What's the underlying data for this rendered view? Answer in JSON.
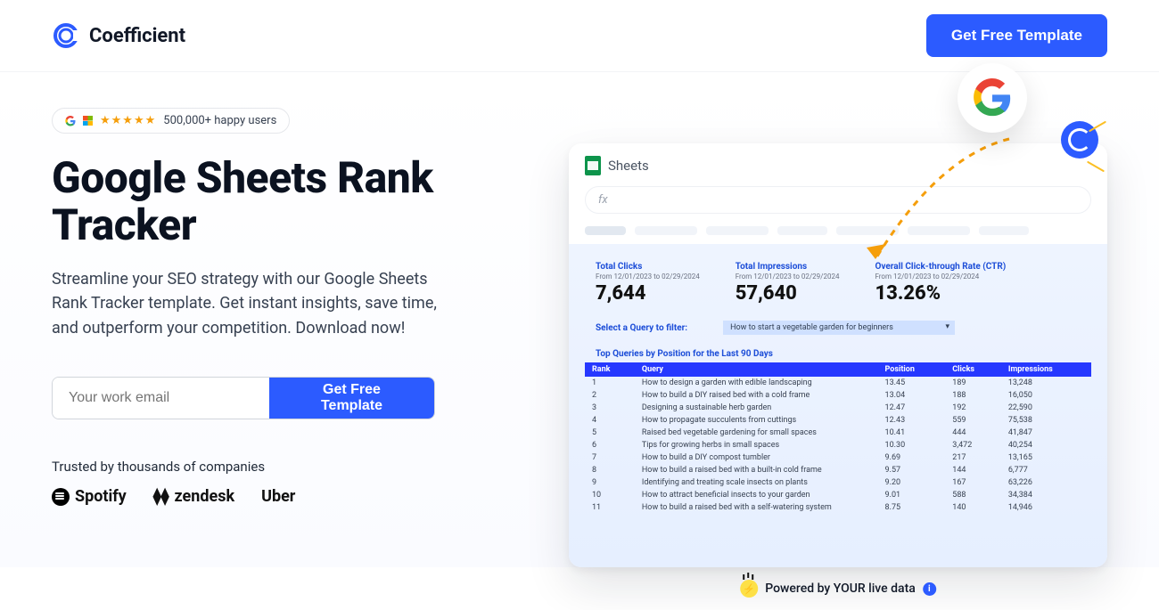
{
  "header": {
    "brand": "Coefficient",
    "cta": "Get Free Template"
  },
  "badge": {
    "stars": "★★★★★",
    "text": "500,000+ happy users"
  },
  "hero": {
    "title": "Google Sheets Rank Tracker",
    "subtitle": "Streamline your SEO strategy with our Google Sheets Rank Tracker template. Get instant insights, save time, and outperform your competition. Download now!",
    "email_placeholder": "Your work email",
    "submit_label": "Get Free Template"
  },
  "trusted": {
    "label": "Trusted by thousands of companies",
    "spotify": "Spotify",
    "zendesk": "zendesk",
    "uber": "Uber"
  },
  "sheet": {
    "app_title": "Sheets",
    "fx": "fx",
    "stats": {
      "clicks_label": "Total Clicks",
      "date_range": "From 12/01/2023 to 02/29/2024",
      "clicks_value": "7,644",
      "impressions_label": "Total Impressions",
      "impressions_value": "57,640",
      "ctr_label": "Overall Click-through Rate (CTR)",
      "ctr_value": "13.26%"
    },
    "filter": {
      "label": "Select a Query to filter:",
      "value": "How to start a vegetable garden for beginners"
    },
    "table_title": "Top Queries by Position for the Last 90 Days",
    "columns": {
      "rank": "Rank",
      "query": "Query",
      "position": "Position",
      "clicks": "Clicks",
      "impressions": "Impressions"
    },
    "rows": [
      {
        "rank": "1",
        "query": "How to design a garden with edible landscaping",
        "position": "13.45",
        "clicks": "189",
        "impressions": "13,248"
      },
      {
        "rank": "2",
        "query": "How to build a DIY raised bed with a cold frame",
        "position": "13.04",
        "clicks": "188",
        "impressions": "16,050"
      },
      {
        "rank": "3",
        "query": "Designing a sustainable herb garden",
        "position": "12.47",
        "clicks": "192",
        "impressions": "22,590"
      },
      {
        "rank": "4",
        "query": "How to propagate succulents from cuttings",
        "position": "12.43",
        "clicks": "559",
        "impressions": "75,538"
      },
      {
        "rank": "5",
        "query": "Raised bed vegetable gardening for small spaces",
        "position": "10.41",
        "clicks": "444",
        "impressions": "41,847"
      },
      {
        "rank": "6",
        "query": "Tips for growing herbs in small spaces",
        "position": "10.30",
        "clicks": "3,472",
        "impressions": "40,254"
      },
      {
        "rank": "7",
        "query": "How to build a DIY compost tumbler",
        "position": "9.69",
        "clicks": "217",
        "impressions": "13,165"
      },
      {
        "rank": "8",
        "query": "How to build a raised bed with a built-in cold frame",
        "position": "9.57",
        "clicks": "144",
        "impressions": "6,777"
      },
      {
        "rank": "9",
        "query": "Identifying and treating scale insects on plants",
        "position": "9.20",
        "clicks": "167",
        "impressions": "63,226"
      },
      {
        "rank": "10",
        "query": "How to attract beneficial insects to your garden",
        "position": "9.01",
        "clicks": "588",
        "impressions": "34,384"
      },
      {
        "rank": "11",
        "query": "How to build a raised bed with a self-watering system",
        "position": "8.75",
        "clicks": "140",
        "impressions": "14,946"
      }
    ]
  },
  "powered": {
    "text": "Powered by YOUR live data"
  }
}
